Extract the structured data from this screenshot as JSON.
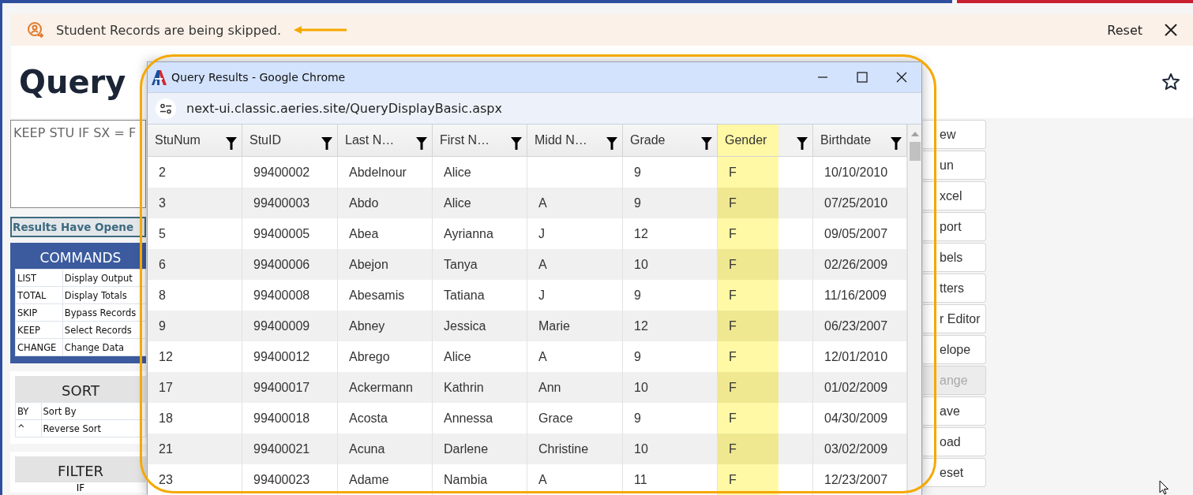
{
  "banner": {
    "message": "Student Records are being skipped.",
    "action": "Reset"
  },
  "page": {
    "title": "Query"
  },
  "query_text": "KEEP STU IF SX = F",
  "status": "Results Have Opene",
  "commands": {
    "title": "COMMANDS",
    "rows": [
      {
        "command": "LIST",
        "description": "Display Output"
      },
      {
        "command": "TOTAL",
        "description": "Display Totals"
      },
      {
        "command": "SKIP",
        "description": "Bypass Records"
      },
      {
        "command": "KEEP",
        "description": "Select Records"
      },
      {
        "command": "CHANGE",
        "description": "Change Data"
      }
    ]
  },
  "sort": {
    "title": "SORT",
    "rows": [
      {
        "command": "BY",
        "description": "Sort By"
      },
      {
        "command": "^",
        "description": "Reverse Sort"
      }
    ]
  },
  "filter": {
    "title": "FILTER",
    "rows": [
      "IF"
    ]
  },
  "right_buttons": [
    {
      "label": "ew",
      "disabled": false
    },
    {
      "label": "un",
      "disabled": false
    },
    {
      "label": "xcel",
      "disabled": false
    },
    {
      "label": "port",
      "disabled": false
    },
    {
      "label": "bels",
      "disabled": false
    },
    {
      "label": "tters",
      "disabled": false
    },
    {
      "label": "r Editor",
      "disabled": false
    },
    {
      "label": "elope",
      "disabled": false
    },
    {
      "label": "ange",
      "disabled": true
    },
    {
      "label": "ave",
      "disabled": false
    },
    {
      "label": "oad",
      "disabled": false
    },
    {
      "label": "eset",
      "disabled": false
    }
  ],
  "popup": {
    "title": "Query Results - Google Chrome",
    "url": "next-ui.classic.aeries.site/QueryDisplayBasic.aspx",
    "columns": [
      {
        "label": "StuNum",
        "highlighted": false
      },
      {
        "label": "StuID",
        "highlighted": false
      },
      {
        "label": "Last N…",
        "highlighted": false
      },
      {
        "label": "First N…",
        "highlighted": false
      },
      {
        "label": "Midd N…",
        "highlighted": false
      },
      {
        "label": "Grade",
        "highlighted": false
      },
      {
        "label": "Gender",
        "highlighted": true
      },
      {
        "label": "Birthdate",
        "highlighted": false
      }
    ],
    "rows": [
      [
        "2",
        "99400002",
        "Abdelnour",
        "Alice",
        null,
        "9",
        "F",
        "10/10/2010"
      ],
      [
        "3",
        "99400003",
        "Abdo",
        "Alice",
        "A",
        "9",
        "F",
        "07/25/2010"
      ],
      [
        "5",
        "99400005",
        "Abea",
        "Ayrianna",
        "J",
        "12",
        "F",
        "09/05/2007"
      ],
      [
        "6",
        "99400006",
        "Abejon",
        "Tanya",
        "A",
        "10",
        "F",
        "02/26/2009"
      ],
      [
        "8",
        "99400008",
        "Abesamis",
        "Tatiana",
        "J",
        "9",
        "F",
        "11/16/2009"
      ],
      [
        "9",
        "99400009",
        "Abney",
        "Jessica",
        "Marie",
        "12",
        "F",
        "06/23/2007"
      ],
      [
        "12",
        "99400012",
        "Abrego",
        "Alice",
        "A",
        "9",
        "F",
        "12/01/2010"
      ],
      [
        "17",
        "99400017",
        "Ackermann",
        "Kathrin",
        "Ann",
        "10",
        "F",
        "01/02/2009"
      ],
      [
        "18",
        "99400018",
        "Acosta",
        "Annessa",
        "Grace",
        "9",
        "F",
        "04/30/2009"
      ],
      [
        "21",
        "99400021",
        "Acuna",
        "Darlene",
        "Christine",
        "10",
        "F",
        "03/02/2009"
      ],
      [
        "23",
        "99400023",
        "Adame",
        "Nambia",
        "A",
        "11",
        "F",
        "12/23/2007"
      ]
    ]
  }
}
